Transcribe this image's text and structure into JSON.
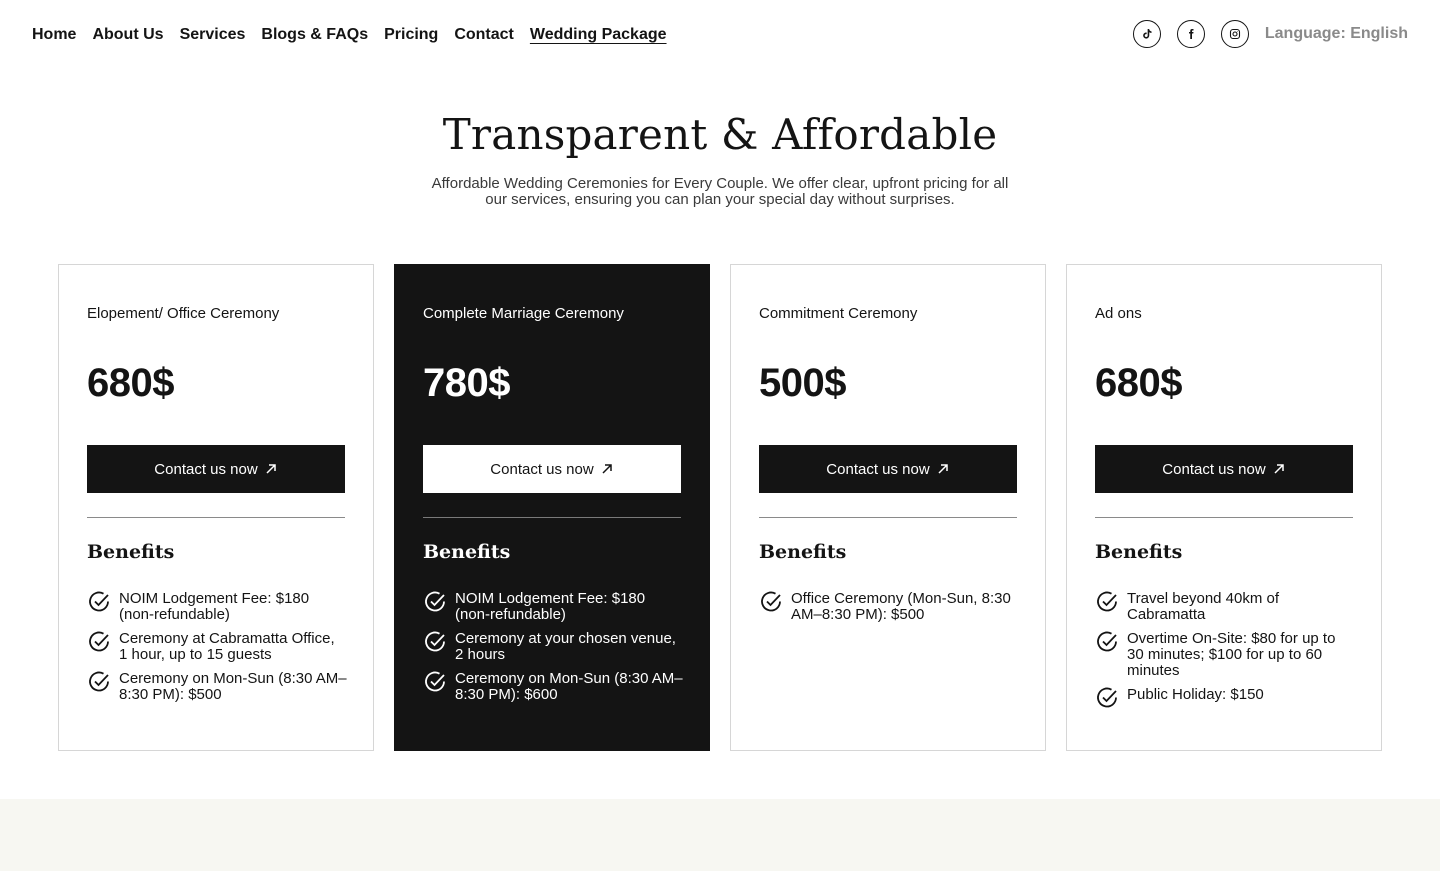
{
  "nav": {
    "links": [
      {
        "label": "Home"
      },
      {
        "label": "About Us"
      },
      {
        "label": "Services"
      },
      {
        "label": "Blogs & FAQs"
      },
      {
        "label": "Pricing"
      },
      {
        "label": "Contact"
      },
      {
        "label": "Wedding Package",
        "active": true
      }
    ],
    "socials": [
      "tiktok-icon",
      "facebook-icon",
      "instagram-icon"
    ],
    "language": "Language: English"
  },
  "hero": {
    "title": "Transparent & Affordable",
    "subtitle": "Affordable Wedding Ceremonies for Every Couple. We offer clear, upfront pricing for all our services, ensuring you can plan your special day without surprises."
  },
  "benefits_heading": "Benefits",
  "cards": [
    {
      "name": "Elopement/ Office Ceremony",
      "price": "680$",
      "button": "Contact us now",
      "benefits": [
        "NOIM Lodgement Fee: $180 (non-refundable)",
        "Ceremony at Cabramatta Office, 1 hour, up to 15 guests",
        "Ceremony on Mon-Sun (8:30 AM–8:30 PM): $500"
      ]
    },
    {
      "name": "Complete Marriage Ceremony",
      "price": "780$",
      "button": "Contact us now",
      "dark": true,
      "benefits": [
        "NOIM Lodgement Fee: $180 (non-refundable)",
        "Ceremony at your chosen venue, 2 hours",
        "Ceremony on Mon-Sun (8:30 AM–8:30 PM): $600"
      ]
    },
    {
      "name": "Commitment Ceremony",
      "price": "500$",
      "button": "Contact us now",
      "benefits": [
        "Office Ceremony (Mon-Sun, 8:30 AM–8:30 PM): $500"
      ]
    },
    {
      "name": "Ad ons",
      "price": "680$",
      "button": "Contact us now",
      "benefits": [
        "Travel beyond 40km of Cabramatta",
        "Overtime On-Site: $80 for up to 30 minutes; $100 for up to 60 minutes",
        "Public Holiday: $150"
      ]
    }
  ],
  "colors": {
    "primary": "#141414",
    "muted": "#8a8a8a",
    "footer_bg": "#f7f7f2"
  }
}
